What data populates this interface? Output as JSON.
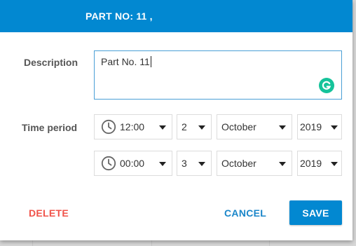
{
  "dialog": {
    "title": "PART NO: 11 ,"
  },
  "description": {
    "label": "Description",
    "value": "Part No. 11"
  },
  "time_period": {
    "label": "Time period",
    "start": {
      "time": "12:00",
      "day": "2",
      "month": "October",
      "year": "2019"
    },
    "end": {
      "time": "00:00",
      "day": "3",
      "month": "October",
      "year": "2019"
    }
  },
  "actions": {
    "delete_label": "DELETE",
    "cancel_label": "CANCEL",
    "save_label": "SAVE"
  },
  "colors": {
    "primary": "#0288d1",
    "danger": "#f0534a",
    "grammarly": "#15c39a"
  },
  "icons": {
    "clock": "clock-icon",
    "dropdown": "caret-down-icon",
    "grammarly": "grammarly-icon"
  }
}
